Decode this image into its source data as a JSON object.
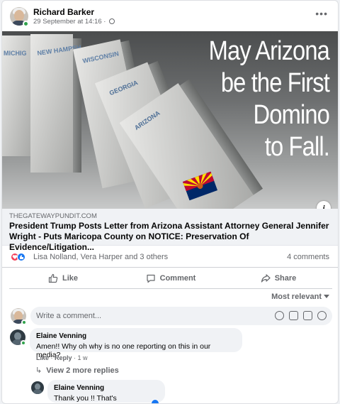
{
  "post": {
    "author": "Richard Barker",
    "timestamp": "29 September at 14:16 ·",
    "more_label": "•••",
    "image": {
      "text_lines": [
        "May Arizona",
        "be the First",
        "Domino",
        "to Fall."
      ],
      "domino_labels": [
        "MICHIG",
        "NEW HAMPSH",
        "WISCONSIN",
        "GEORGIA",
        "ARIZONA"
      ]
    },
    "info_label": "i",
    "link": {
      "domain": "THEGATEWAYPUNDIT.COM",
      "title": "President Trump Posts Letter from Arizona Assistant Attorney General Jennifer Wright - Puts Maricopa County on NOTICE: Preservation Of Evidence/Litigation..."
    },
    "reactions": {
      "names": "Lisa Nolland, Vera Harper and 3 others",
      "comments_count": "4 comments"
    },
    "actions": {
      "like": "Like",
      "comment": "Comment",
      "share": "Share"
    },
    "sort_label": "Most relevant",
    "write_placeholder": "Write a comment..."
  },
  "comments": [
    {
      "author": "Elaine Venning",
      "text": "Amen!! Why oh why is no one reporting on this in our media?",
      "like": "Like",
      "reply": "Reply",
      "age": "1 w"
    }
  ],
  "view_replies": "View 2 more replies",
  "reply": {
    "author": "Elaine Venning",
    "text": "Thank you !! That's encouraging."
  },
  "colors": {
    "accent": "#1877f2",
    "online": "#31a24c",
    "love": "#f33e58",
    "secondary_text": "#65676b",
    "arizona_red": "#bf0a30",
    "arizona_blue": "#002868",
    "arizona_copper": "#ce5c17",
    "arizona_gold": "#fedf00"
  }
}
